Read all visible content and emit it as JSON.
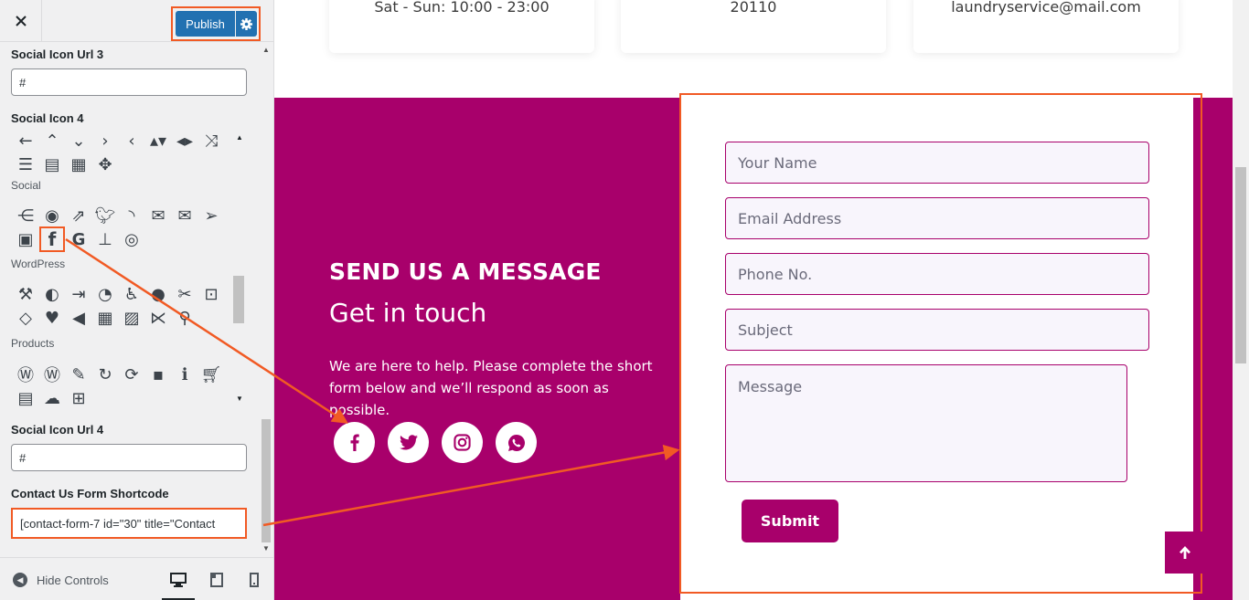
{
  "colors": {
    "accent": "#a8006b",
    "highlight": "#f15a24",
    "publish": "#2271b1"
  },
  "sidebar": {
    "publish_label": "Publish",
    "fields": {
      "social_icon_url_3_label": "Social Icon Url 3",
      "social_icon_url_3_value": "#",
      "social_icon_4_label": "Social Icon 4",
      "social_icon_url_4_label": "Social Icon Url 4",
      "social_icon_url_4_value": "#",
      "contact_form_label": "Contact Us Form Shortcode",
      "contact_form_value": "[contact-form-7 id=\"30\" title=\"Contact"
    },
    "icon_groups": {
      "social": "Social",
      "wordpress": "WordPress",
      "products": "Products"
    },
    "hide_controls_label": "Hide Controls"
  },
  "preview": {
    "info_cards": [
      "Sat - Sun: 10:00 - 23:00",
      "20110",
      "laundryservice@mail.com"
    ],
    "send_title": "SEND US A MESSAGE",
    "get_in_touch": "Get in touch",
    "help_text": "We are here to help. Please complete the short form below and we’ll respond as soon as possible.",
    "form": {
      "name_placeholder": "Your Name",
      "email_placeholder": "Email Address",
      "phone_placeholder": "Phone No.",
      "subject_placeholder": "Subject",
      "message_placeholder": "Message",
      "submit_label": "Submit"
    }
  }
}
